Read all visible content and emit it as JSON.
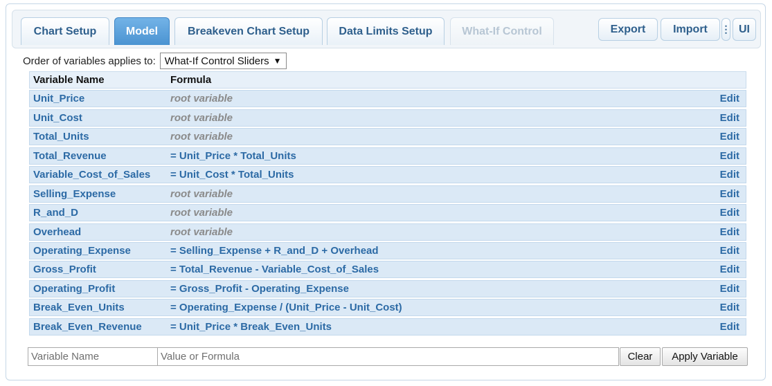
{
  "tabs": [
    {
      "label": "Chart Setup"
    },
    {
      "label": "Model"
    },
    {
      "label": "Breakeven Chart Setup"
    },
    {
      "label": "Data Limits Setup"
    },
    {
      "label": "What-If Control"
    }
  ],
  "toolbar": {
    "export_label": "Export",
    "import_label": "Import",
    "more_icon": "⋮",
    "ui_label": "UI"
  },
  "order": {
    "label": "Order of variables applies to:",
    "selected": "What-If Control Sliders",
    "arrow": "▼"
  },
  "table": {
    "headers": {
      "name": "Variable Name",
      "formula": "Formula"
    },
    "edit_label": "Edit",
    "rows": [
      {
        "name": "Unit_Price",
        "formula": "root variable"
      },
      {
        "name": "Unit_Cost",
        "formula": "root variable"
      },
      {
        "name": "Total_Units",
        "formula": "root variable"
      },
      {
        "name": "Total_Revenue",
        "formula": "= Unit_Price * Total_Units"
      },
      {
        "name": "Variable_Cost_of_Sales",
        "formula": "= Unit_Cost * Total_Units"
      },
      {
        "name": "Selling_Expense",
        "formula": "root variable"
      },
      {
        "name": "R_and_D",
        "formula": "root variable"
      },
      {
        "name": "Overhead",
        "formula": "root variable"
      },
      {
        "name": "Operating_Expense",
        "formula": "= Selling_Expense + R_and_D + Overhead"
      },
      {
        "name": "Gross_Profit",
        "formula": "= Total_Revenue - Variable_Cost_of_Sales"
      },
      {
        "name": "Operating_Profit",
        "formula": "= Gross_Profit - Operating_Expense"
      },
      {
        "name": "Break_Even_Units",
        "formula": "= Operating_Expense / (Unit_Price - Unit_Cost)"
      },
      {
        "name": "Break_Even_Revenue",
        "formula": "= Unit_Price * Break_Even_Units"
      }
    ]
  },
  "editor": {
    "name_placeholder": "Variable Name",
    "value_placeholder": "Value or Formula",
    "clear_label": "Clear",
    "apply_label": "Apply Variable"
  }
}
